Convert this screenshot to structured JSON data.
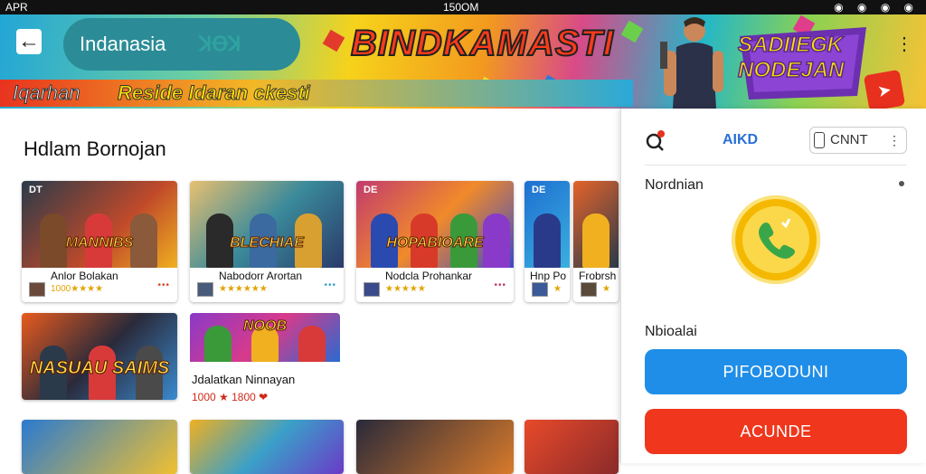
{
  "status_bar": {
    "left": "APR",
    "time": "150OM",
    "right_icons": "◉ ◉ ◉ ◉"
  },
  "header": {
    "back_icon": "arrow-left-icon",
    "search_text": "Indanasia",
    "search_ghost": "ꓘꝊꓘ",
    "banner_title": "BINDKAMASTI",
    "ticker_a": "Iqarhan",
    "ticker_b": "Reside Idaran ckesti",
    "badge_line1": "SADIIEGK",
    "badge_line2": "NODEJAN",
    "menu_icon": "more-vertical-icon"
  },
  "section": {
    "title": "Hdlam Bornojan",
    "cards": [
      {
        "caption": "MANNIBS",
        "name": "Anlor Bolakan",
        "stars": "1000★★★★",
        "corner": "DT",
        "accent": "#d8462a"
      },
      {
        "caption": "BLECHIAE",
        "name": "Nabodorr Arortan",
        "stars": "★★★★★★",
        "corner": "",
        "accent": "#3aa0c8"
      },
      {
        "caption": "HOPABIOARE",
        "name": "Nodcla Prohankar",
        "stars": "★★★★★",
        "corner": "DE",
        "accent": "#c23b6e"
      },
      {
        "caption": "",
        "name": "Hnp Po",
        "stars": "★",
        "corner": "DE",
        "accent": "#1e6fd0"
      },
      {
        "caption": "",
        "name": "Frobrsh",
        "stars": "★",
        "corner": "",
        "accent": "#e4632a"
      },
      {
        "caption": "NASUAU SAIMS",
        "name": "",
        "stars": "",
        "corner": "",
        "accent": "#e85a1e"
      },
      {
        "caption": "NOOB",
        "name": "Jdalatkan Ninnayan",
        "stars": "1000 ★ 1800 ❤",
        "corner": "",
        "accent": "#8a3ac8"
      }
    ]
  },
  "side_panel": {
    "search_icon": "search-icon",
    "aiko_label": "AIKD",
    "chip_label": "CNNT",
    "label_top": "Nordnian",
    "call_icon": "phone-call-icon",
    "label_bottom": "Nbioalai",
    "primary_button": "PIFOBODUNI",
    "secondary_button": "ACUNDE",
    "colors": {
      "primary": "#1f8ee8",
      "secondary": "#f0361c",
      "call": "#f5b800"
    }
  }
}
